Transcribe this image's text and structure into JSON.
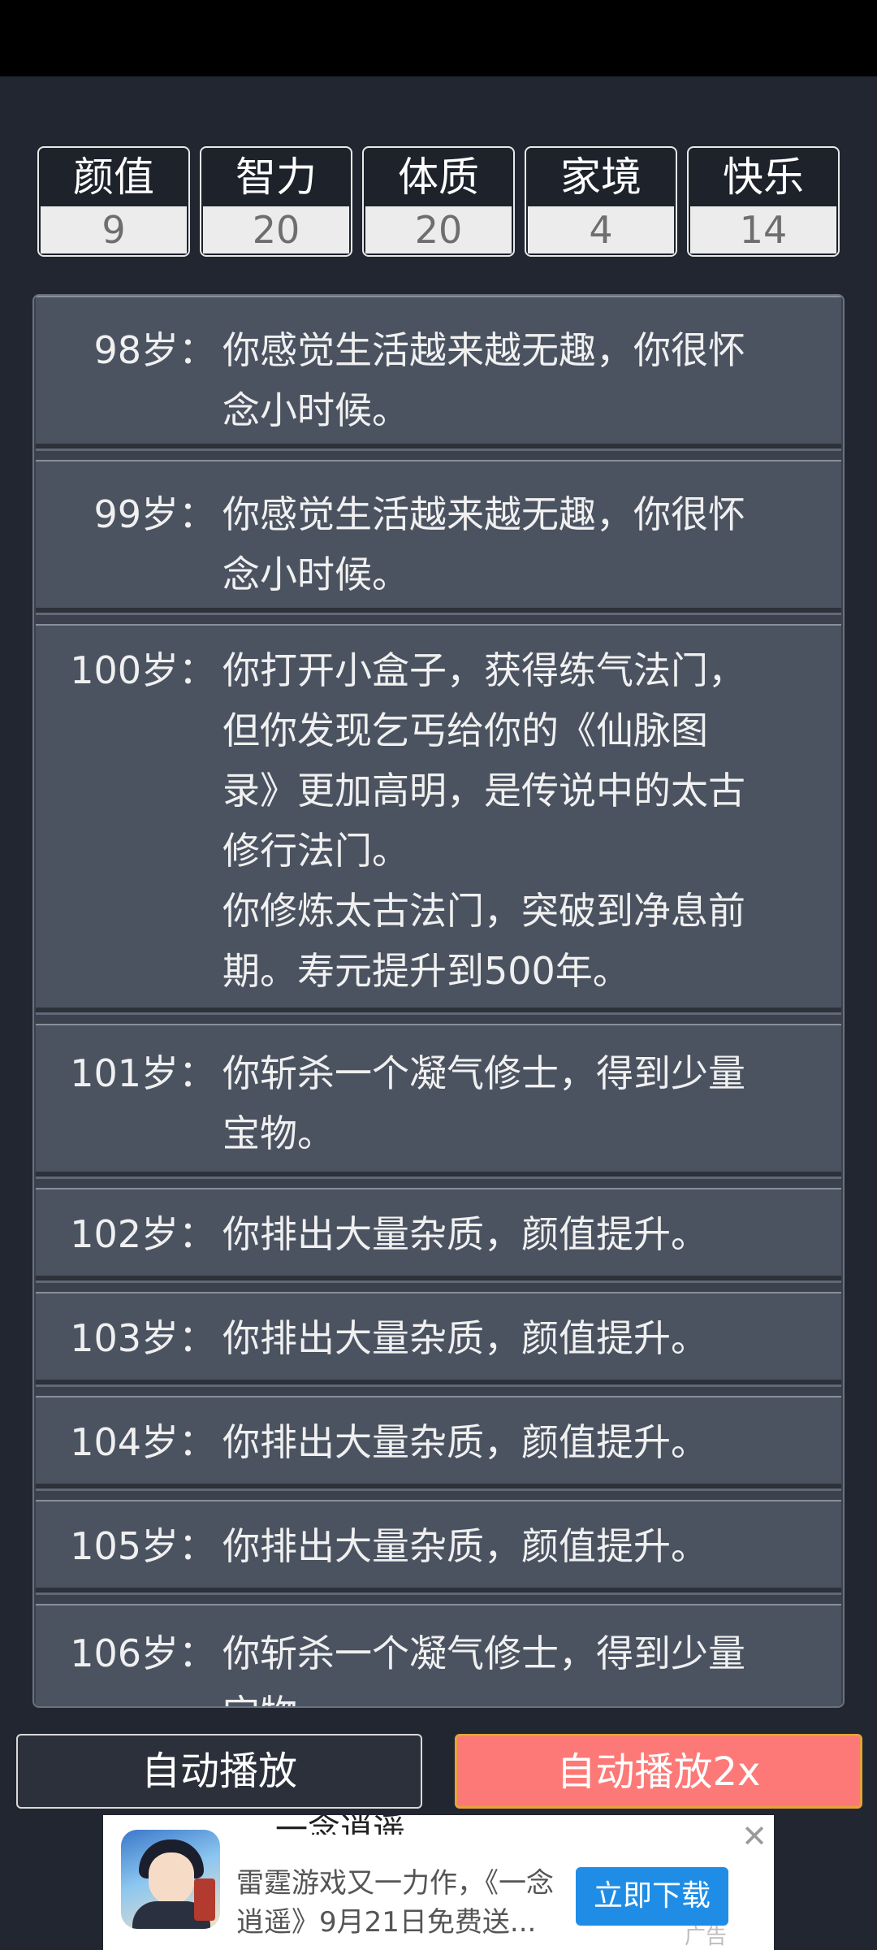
{
  "stats": [
    {
      "label": "颜值",
      "value": "9"
    },
    {
      "label": "智力",
      "value": "20"
    },
    {
      "label": "体质",
      "value": "20"
    },
    {
      "label": "家境",
      "value": "4"
    },
    {
      "label": "快乐",
      "value": "14"
    }
  ],
  "events": [
    {
      "age": "98岁：",
      "text": "你感觉生活越来越无趣，你很怀\n念小时候。"
    },
    {
      "age": "99岁：",
      "text": "你感觉生活越来越无趣，你很怀\n念小时候。"
    },
    {
      "age": "100岁：",
      "text": "你打开小盒子，获得练气法门，\n但你发现乞丐给你的《仙脉图\n录》更加高明，是传说中的太古\n修行法门。\n你修炼太古法门，突破到净息前\n期。寿元提升到500年。"
    },
    {
      "age": "101岁：",
      "text": "你斩杀一个凝气修士，得到少量\n宝物。"
    },
    {
      "age": "102岁：",
      "text": "你排出大量杂质，颜值提升。"
    },
    {
      "age": "103岁：",
      "text": "你排出大量杂质，颜值提升。"
    },
    {
      "age": "104岁：",
      "text": "你排出大量杂质，颜值提升。"
    },
    {
      "age": "105岁：",
      "text": "你排出大量杂质，颜值提升。"
    },
    {
      "age": "106岁：",
      "text": "你斩杀一个凝气修士，得到少量\n宝物。"
    }
  ],
  "buttons": {
    "auto_play": "自动播放",
    "auto_play_2x": "自动播放2x"
  },
  "ad": {
    "title": "一念逍遥",
    "description": "雷霆游戏又一力作，《一念逍遥》9月21日免费送...",
    "cta": "立即下载",
    "close": "✕",
    "tag": "广告"
  },
  "colors": {
    "background": "#222630",
    "event_card": "#4b5361",
    "accent_button": "#fd7977",
    "ad_cta": "#1f8de6"
  }
}
